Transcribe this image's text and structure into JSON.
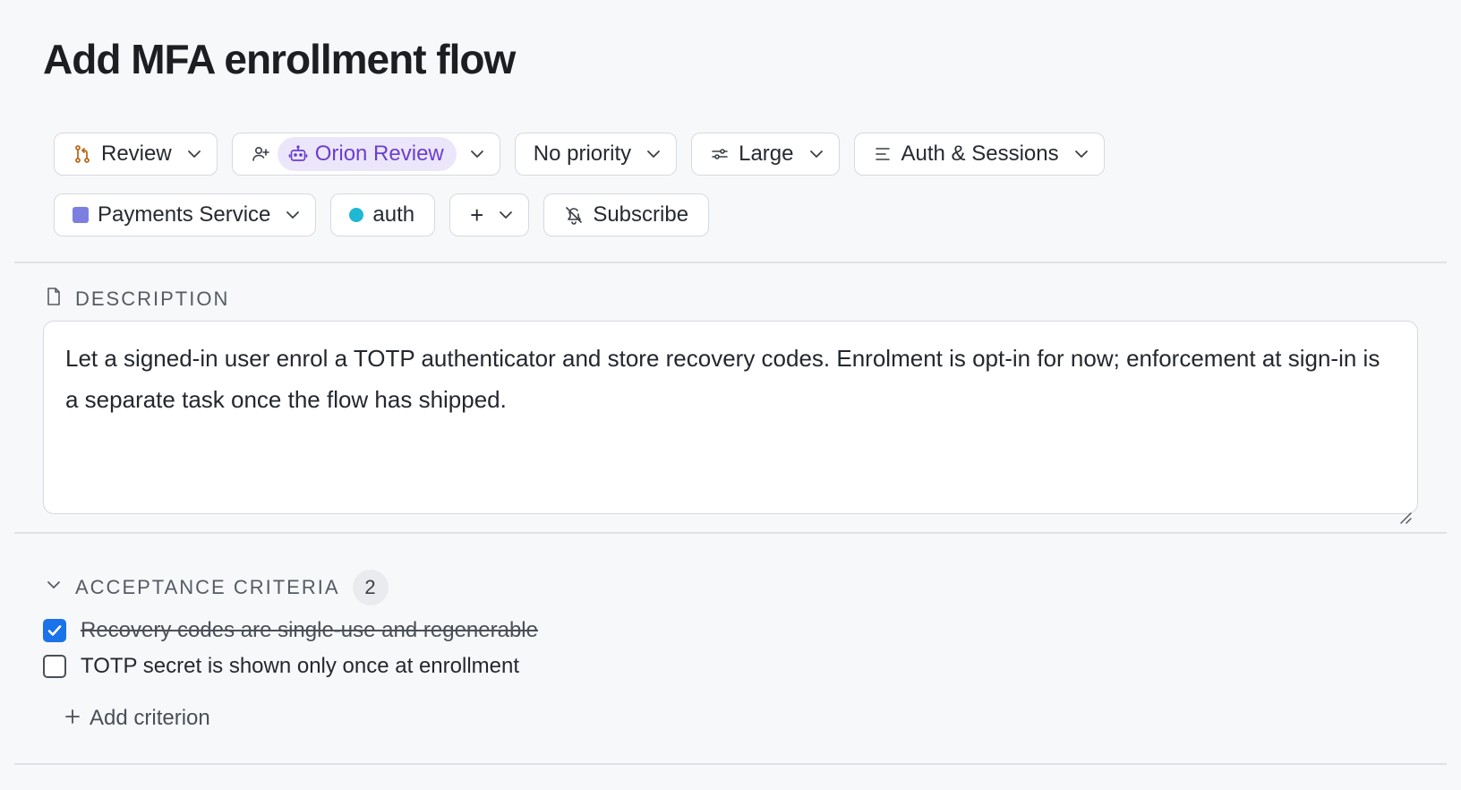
{
  "issue": {
    "title": "Add MFA enrollment flow"
  },
  "properties": {
    "status": {
      "label": "Review",
      "icon": "git-branch-icon",
      "icon_color": "#b8691d"
    },
    "assignee": {
      "label": "Orion Review",
      "icon": "bot-icon",
      "chip_bg": "#ece6fb",
      "chip_color": "#6b3fd0"
    },
    "priority": {
      "label": "No priority"
    },
    "estimate": {
      "label": "Large",
      "icon": "sliders-icon"
    },
    "cycle": {
      "label": "Auth & Sessions",
      "icon": "list-lines-icon"
    },
    "project": {
      "label": "Payments Service",
      "color": "#7c7fe0"
    },
    "label_tag": {
      "label": "auth",
      "color": "#1fb8d4"
    },
    "add_property": {
      "label": "+"
    },
    "subscribe": {
      "label": "Subscribe",
      "icon": "bell-off-icon"
    }
  },
  "description": {
    "heading": "DESCRIPTION",
    "text": "Let a signed-in user enrol a TOTP authenticator and store recovery codes. Enrolment is opt-in for now; enforcement at sign-in is a separate task once the flow has shipped."
  },
  "acceptance_criteria": {
    "heading": "ACCEPTANCE CRITERIA",
    "count": "2",
    "items": [
      {
        "label": "Recovery codes are single-use and regenerable",
        "checked": true
      },
      {
        "label": "TOTP secret is shown only once at enrollment",
        "checked": false
      }
    ],
    "add_label": "Add criterion"
  },
  "colors": {
    "accent": "#1a73e8",
    "border": "#d6d9de",
    "background": "#f7f8fa"
  }
}
